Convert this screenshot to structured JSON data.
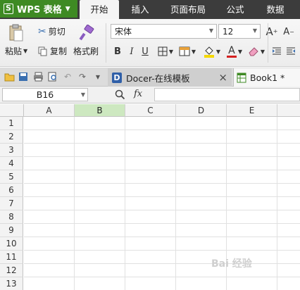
{
  "app": {
    "name": "WPS 表格",
    "logo": "S"
  },
  "menu": {
    "tabs": [
      "开始",
      "插入",
      "页面布局",
      "公式",
      "数据"
    ],
    "active": "开始"
  },
  "ribbon": {
    "paste_label": "粘贴",
    "cut_label": "剪切",
    "copy_label": "复制",
    "format_painter_label": "格式刷",
    "font_name": "宋体",
    "font_size": "12",
    "bold": "B",
    "italic": "I",
    "underline": "U",
    "grow_font": "A",
    "shrink_font": "A",
    "font_color_glyph": "A",
    "accent_green": "#3e8a23",
    "font_color_red": "#d42020",
    "fill_yellow": "#f5d800"
  },
  "tabs": [
    {
      "label": "Docer-在线模板",
      "close": "×"
    },
    {
      "label": "Book1 *"
    }
  ],
  "formula_bar": {
    "cell_ref": "B16",
    "fx": "fx"
  },
  "grid": {
    "columns": [
      "A",
      "B",
      "C",
      "D",
      "E"
    ],
    "selected_column": "B",
    "rows": [
      "1",
      "2",
      "3",
      "4",
      "5",
      "6",
      "7",
      "8",
      "9",
      "10",
      "11",
      "12",
      "13"
    ]
  },
  "watermark": "Bai 经验"
}
